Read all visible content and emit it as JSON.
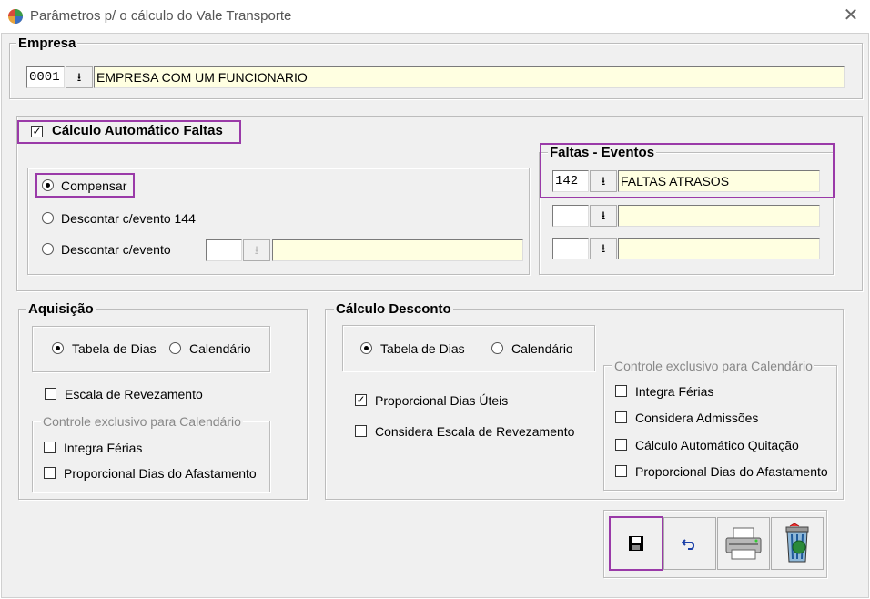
{
  "window": {
    "title": "Parâmetros p/ o cálculo do Vale Transporte"
  },
  "empresa": {
    "legend": "Empresa",
    "code": "0001",
    "name": "EMPRESA COM UM FUNCIONARIO"
  },
  "calculo_faltas": {
    "legend": "Cálculo Automático Faltas",
    "checked": true,
    "options": {
      "compensar": "Compensar",
      "descontar_144": "Descontar c/evento 144",
      "descontar_evento": "Descontar c/evento"
    },
    "selected": "compensar"
  },
  "faltas_eventos": {
    "legend": "Faltas - Eventos",
    "rows": [
      {
        "code": "142",
        "name": "FALTAS ATRASOS"
      },
      {
        "code": "",
        "name": ""
      },
      {
        "code": "",
        "name": ""
      }
    ]
  },
  "aquisicao": {
    "legend": "Aquisição",
    "tabela": "Tabela de Dias",
    "calendario": "Calendário",
    "escala": "Escala de Revezamento",
    "sub_legend": "Controle exclusivo para Calendário",
    "integra_ferias": "Integra Férias",
    "proporcional": "Proporcional Dias do Afastamento"
  },
  "calculo_desconto": {
    "legend": "Cálculo Desconto",
    "tabela": "Tabela de Dias",
    "calendario": "Calendário",
    "proporcional_uteis": "Proporcional Dias Úteis",
    "considera_escala": "Considera Escala de Revezamento",
    "sub_legend": "Controle exclusivo para Calendário",
    "integra_ferias": "Integra Férias",
    "considera_admissoes": "Considera Admissões",
    "calculo_quitacao": "Cálculo Automático Quitação",
    "proporcional_afastamento": "Proporcional Dias do Afastamento"
  },
  "icons": {
    "download": "⭳",
    "check": "✓"
  },
  "colors": {
    "highlight": "#9a3aa8",
    "lookup_bg": "#ffffe1"
  }
}
